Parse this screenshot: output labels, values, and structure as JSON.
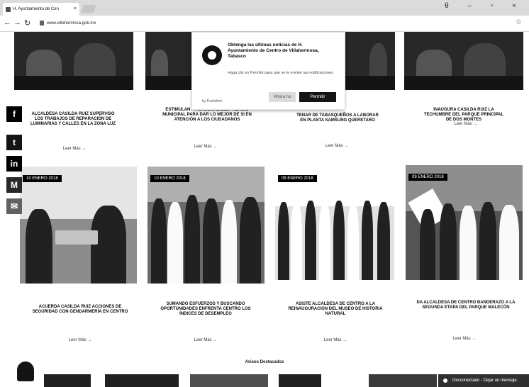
{
  "browser": {
    "tab_title": "H. Ayuntamiento de Cen",
    "url": "www.villahermosa.gob.mx",
    "window_controls": "θ – ▫ ×"
  },
  "social": [
    {
      "icon": "facebook-icon",
      "glyph": "f",
      "color": "#111111"
    },
    {
      "icon": "twitter-icon",
      "glyph": "t",
      "color": "#222222"
    },
    {
      "icon": "linkedin-icon",
      "glyph": "in",
      "color": "#111111"
    },
    {
      "icon": "gmail-icon",
      "glyph": "M",
      "color": "#333333"
    },
    {
      "icon": "mail-icon",
      "glyph": "✉",
      "color": "#666666"
    }
  ],
  "top_row": [
    {
      "caption": "ALCALDESA CASILDA RUIZ SUPERVISO LOS TRABAJOS DE REPARACIÓN DE LUMINARIAS Y CALLES EN LA ZONA LUZ",
      "more": "Leer Más →"
    },
    {
      "caption": "ESTIMULAN A PERSONAL DEL PALACIO MUNICIPAL PARA DAR LO MEJOR DE SI EN ATENCIÓN A LOS CIUDADANOS",
      "more": "Leer Más →"
    },
    {
      "caption": "TENAR DE TABASQUEÑOS A LABORAR EN PLANTA SAMSUNG QUERETARO",
      "more": "Leer Más →"
    },
    {
      "caption": "INAUGURA CASILDA RUIZ LA TECHUMBRE DEL PARQUE PRINCIPAL DE DOS MONTES",
      "more": "Leer Más →"
    }
  ],
  "bottom_row": [
    {
      "date": "10 ENERO 2018",
      "caption": "ACUERDA CASILDA RUIZ ACCIONES DE SEGURIDAD CON GENDARMERÍA EN CENTRO",
      "more": "Leer Más →"
    },
    {
      "date": "10 ENERO 2018",
      "caption": "SUMANDO ESFUERZOS Y BUSCANDO OPORTUNIDADES ENFRENTA CENTRO LOS ÍNDICES DE DESEMPLEO",
      "more": "Leer Más →"
    },
    {
      "date": "09 ENERO 2018",
      "caption": "ASISTE ALCALDESA DE CENTRO A LA REINAUGURACIÓN DEL MUSEO DE HISTORIA NATURAL",
      "more": "Leer Más →"
    },
    {
      "date": "09 ENERO 2018",
      "caption": "DA ALCALDESA DE CENTRO BANDERAZO A LA SEGUNDA ETAPA DEL PARQUE MALECÓN",
      "more": "Leer Más →"
    }
  ],
  "popup": {
    "title": "Obtenga las últimas noticias de H. Ayuntamiento de Centro de Villahermosa, Tabasco",
    "body": "Haga clic en Permitir para que se le envíen las notificaciones",
    "decline": "Ahora no",
    "accept": "Permitir",
    "brand": "by PushAlert"
  },
  "section_heading": "Avisos Destacados",
  "chat": "Desconectado - Dejar un mensaje"
}
